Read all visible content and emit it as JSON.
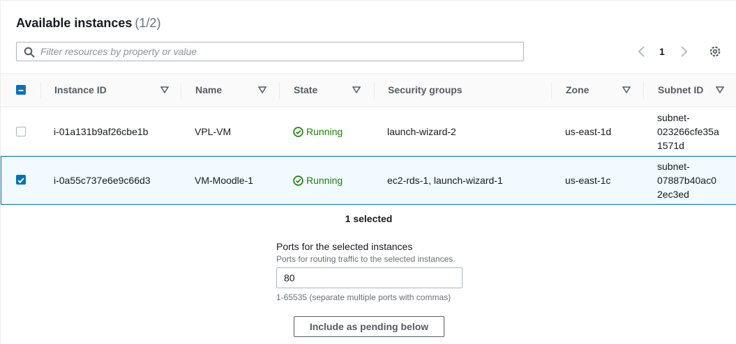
{
  "header": {
    "title": "Available instances",
    "count": "(1/2)"
  },
  "search": {
    "placeholder": "Filter resources by property or value",
    "value": ""
  },
  "pagination": {
    "current_page": "1"
  },
  "table": {
    "columns": [
      "Instance ID",
      "Name",
      "State",
      "Security groups",
      "Zone",
      "Subnet ID"
    ],
    "rows": [
      {
        "selected": false,
        "instance_id": "i-01a131b9af26cbe1b",
        "name": "VPL-VM",
        "state": "Running",
        "security_groups": "launch-wizard-2",
        "zone": "us-east-1d",
        "subnet_lines": [
          "subnet-",
          "023266cfe35a",
          "1571d"
        ]
      },
      {
        "selected": true,
        "instance_id": "i-0a55c737e6e9c66d3",
        "name": "VM-Moodle-1",
        "state": "Running",
        "security_groups": "ec2-rds-1, launch-wizard-1",
        "zone": "us-east-1c",
        "subnet_lines": [
          "subnet-",
          "07887b40ac0",
          "2ec3ed"
        ]
      }
    ]
  },
  "footer": {
    "selected_text": "1 selected",
    "ports_label": "Ports for the selected instances",
    "ports_description": "Ports for routing traffic to the selected instances.",
    "ports_value": "80",
    "ports_hint": "1-65535 (separate multiple ports with commas)",
    "include_button": "Include as pending below"
  },
  "colors": {
    "accent": "#0073bb",
    "running": "#1d8102",
    "selected_row_bg": "#f1faff"
  }
}
